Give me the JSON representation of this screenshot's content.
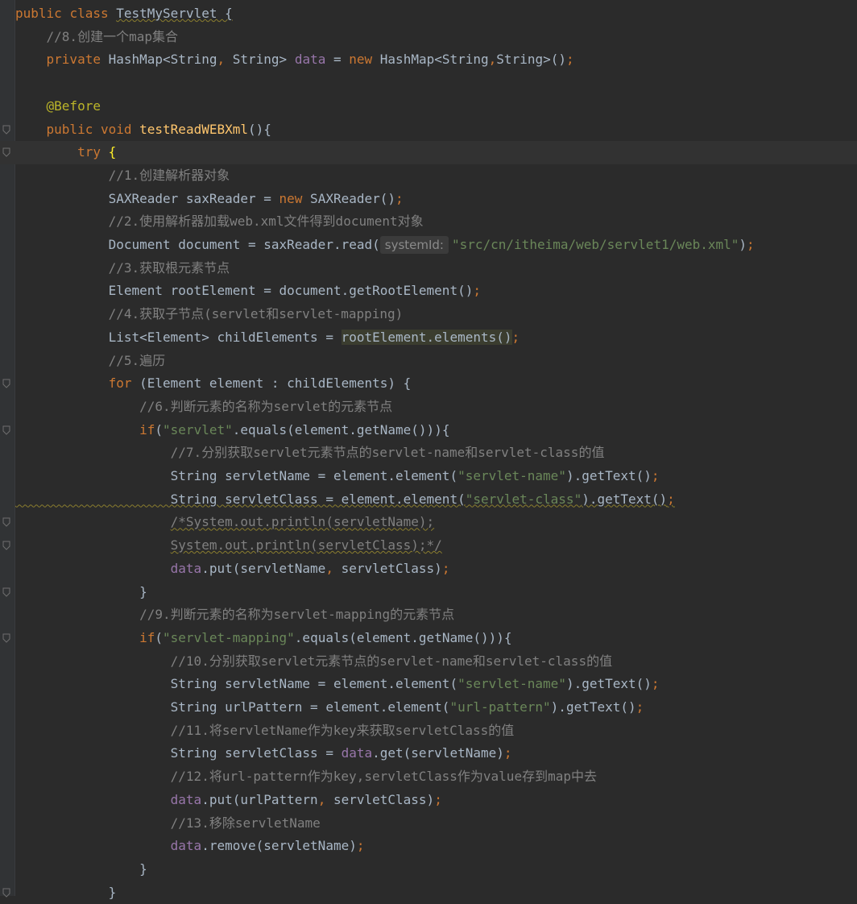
{
  "editor": {
    "lines": [
      {
        "t": "public class TestMyServlet {"
      },
      {
        "t": "    //8.创建一个map集合"
      },
      {
        "t": "    private HashMap<String, String> data = new HashMap<String,String>();"
      },
      {
        "t": ""
      },
      {
        "t": "    @Before"
      },
      {
        "t": "    public void testReadWEBXml(){"
      },
      {
        "t": "        try {"
      },
      {
        "t": "            //1.创建解析器对象"
      },
      {
        "t": "            SAXReader saxReader = new SAXReader();"
      },
      {
        "t": "            //2.使用解析器加载web.xml文件得到document对象"
      },
      {
        "t": "            Document document = saxReader.read(systemId: \"src/cn/itheima/web/servlet1/web.xml\");"
      },
      {
        "t": "            //3.获取根元素节点"
      },
      {
        "t": "            Element rootElement = document.getRootElement();"
      },
      {
        "t": "            //4.获取子节点(servlet和servlet-mapping)"
      },
      {
        "t": "            List<Element> childElements = rootElement.elements();"
      },
      {
        "t": "            //5.遍历"
      },
      {
        "t": "            for (Element element : childElements) {"
      },
      {
        "t": "                //6.判断元素的名称为servlet的元素节点"
      },
      {
        "t": "                if(\"servlet\".equals(element.getName())){"
      },
      {
        "t": "                    //7.分别获取servlet元素节点的servlet-name和servlet-class的值"
      },
      {
        "t": "                    String servletName = element.element(\"servlet-name\").getText();"
      },
      {
        "t": "                    String servletClass = element.element(\"servlet-class\").getText();"
      },
      {
        "t": "                    /*System.out.println(servletName);"
      },
      {
        "t": "                    System.out.println(servletClass);*/"
      },
      {
        "t": "                    data.put(servletName, servletClass);"
      },
      {
        "t": "                }"
      },
      {
        "t": "                //9.判断元素的名称为servlet-mapping的元素节点"
      },
      {
        "t": "                if(\"servlet-mapping\".equals(element.getName())){"
      },
      {
        "t": "                    //10.分别获取servlet元素节点的servlet-name和servlet-class的值"
      },
      {
        "t": "                    String servletName = element.element(\"servlet-name\").getText();"
      },
      {
        "t": "                    String urlPattern = element.element(\"url-pattern\").getText();"
      },
      {
        "t": "                    //11.将servletName作为key来获取servletClass的值"
      },
      {
        "t": "                    String servletClass = data.get(servletName);"
      },
      {
        "t": "                    //12.将url-pattern作为key,servletClass作为value存到map中去"
      },
      {
        "t": "                    data.put(urlPattern, servletClass);"
      },
      {
        "t": "                    //13.移除servletName"
      },
      {
        "t": "                    data.remove(servletName);"
      },
      {
        "t": "                }"
      },
      {
        "t": "            }"
      }
    ]
  }
}
